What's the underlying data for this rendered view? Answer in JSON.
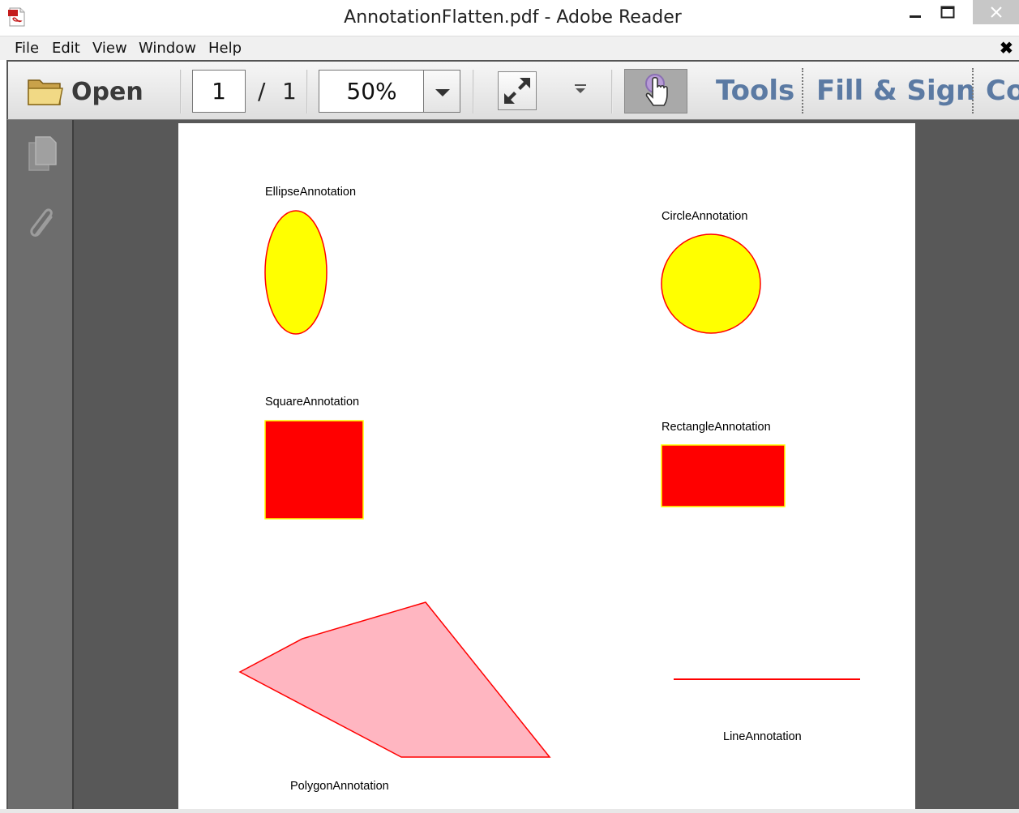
{
  "window": {
    "title": "AnnotationFlatten.pdf - Adobe Reader"
  },
  "menu": {
    "items": [
      "File",
      "Edit",
      "View",
      "Window",
      "Help"
    ],
    "close_glyph": "✖"
  },
  "toolbar": {
    "open_label": "Open",
    "page_current": "1",
    "page_separator": "/",
    "page_total": "1",
    "zoom": "50%",
    "tools_label": "Tools",
    "fill_sign_label": "Fill & Sign",
    "comment_label_partial": "Co"
  },
  "document": {
    "annotations": {
      "ellipse": "EllipseAnnotation",
      "circle": "CircleAnnotation",
      "square": "SquareAnnotation",
      "rectangle": "RectangleAnnotation",
      "polygon": "PolygonAnnotation",
      "line": "LineAnnotation"
    },
    "colors": {
      "yellow_fill": "#ffff00",
      "red": "#ff0000",
      "pink_fill": "#ffb6c1"
    }
  }
}
